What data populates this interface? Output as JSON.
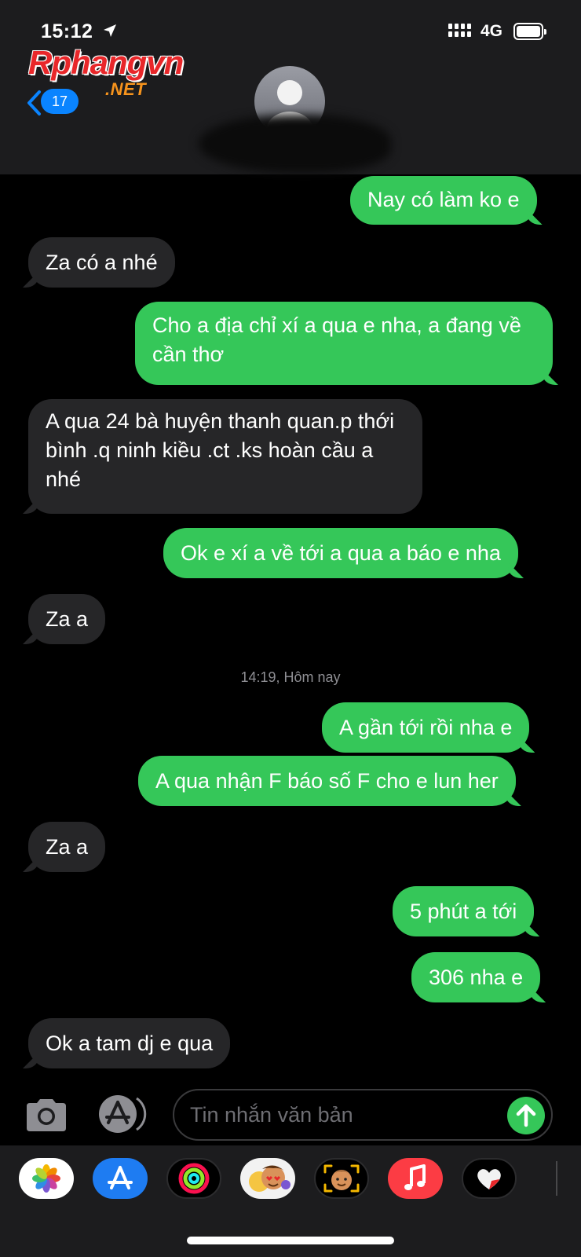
{
  "status_bar": {
    "time": "15:12",
    "network": "4G",
    "icons": [
      "location-arrow-icon",
      "signal-dots-icon",
      "battery-icon"
    ]
  },
  "watermark": {
    "logo_main": "Rphangvn",
    "logo_sub": ".NET"
  },
  "header": {
    "back_badge_count": "17",
    "contact_avatar": "person-silhouette-icon",
    "contact_name_redacted": true
  },
  "colors": {
    "outgoing_bubble": "#35c759",
    "incoming_bubble": "#262628",
    "badge_blue": "#0a84ff",
    "header_bg": "#1c1c1e"
  },
  "messages": [
    {
      "direction": "out",
      "text": "Nay có làm ko e"
    },
    {
      "direction": "in",
      "text": "Za có a nhé"
    },
    {
      "direction": "out",
      "text": "Cho a địa chỉ xí a qua e nha, a đang về cần thơ"
    },
    {
      "direction": "in",
      "text": "A qua 24 bà huyện thanh quan.p thới bình  .q ninh kiều .ct .ks hoàn cầu a nhé"
    },
    {
      "direction": "out",
      "text": "Ok e xí a về tới a qua a báo e nha"
    },
    {
      "direction": "in",
      "text": "Za a"
    },
    {
      "direction": "out",
      "text": "A gần tới rồi nha e"
    },
    {
      "direction": "out",
      "text": "A qua nhận F báo số F cho e lun her"
    },
    {
      "direction": "in",
      "text": "Za a"
    },
    {
      "direction": "out",
      "text": "5 phút a tới"
    },
    {
      "direction": "out",
      "text": "306 nha e"
    },
    {
      "direction": "in",
      "text": "Ok a tam dj e qua"
    }
  ],
  "timestamp_divider": "14:19, Hôm nay",
  "composer": {
    "placeholder": "Tin nhắn văn bản",
    "value": "",
    "camera_icon": "camera-icon",
    "appstore_icon": "app-store-icon",
    "send_icon": "arrow-up-icon"
  },
  "app_drawer": [
    "photos-icon",
    "app-store-icon",
    "activity-rings-icon",
    "memoji-stickers-icon",
    "memoji-icon",
    "music-icon",
    "digital-touch-heart-icon"
  ]
}
